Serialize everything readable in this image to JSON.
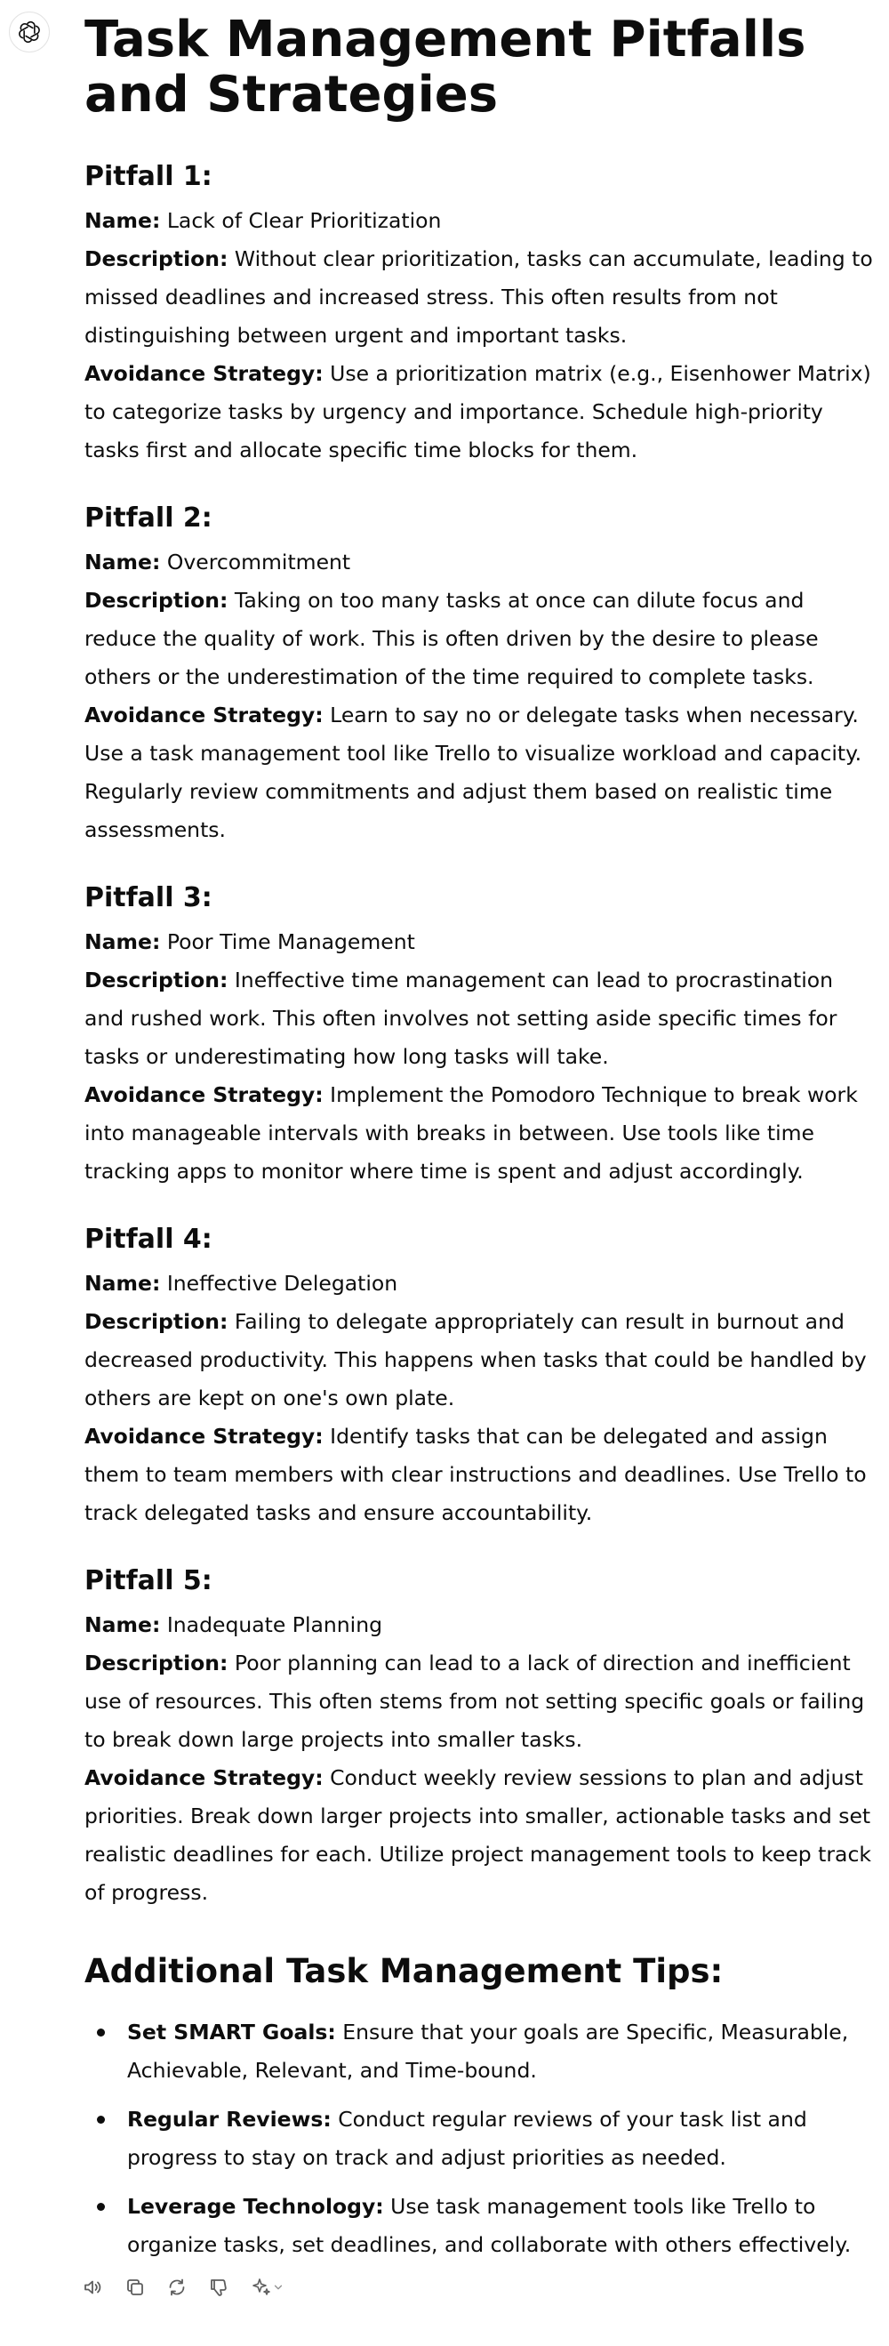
{
  "title": "Task Management Pitfalls and Strategies",
  "labels": {
    "name": "Name:",
    "description": "Description:",
    "strategy": "Avoidance Strategy:"
  },
  "pitfalls": [
    {
      "heading": "Pitfall 1:",
      "name": "Lack of Clear Prioritization",
      "description": "Without clear prioritization, tasks can accumulate, leading to missed deadlines and increased stress. This often results from not distinguishing between urgent and important tasks.",
      "strategy": "Use a prioritization matrix (e.g., Eisenhower Matrix) to categorize tasks by urgency and importance. Schedule high-priority tasks first and allocate specific time blocks for them."
    },
    {
      "heading": "Pitfall 2:",
      "name": "Overcommitment",
      "description": "Taking on too many tasks at once can dilute focus and reduce the quality of work. This is often driven by the desire to please others or the underestimation of the time required to complete tasks.",
      "strategy": "Learn to say no or delegate tasks when necessary. Use a task management tool like Trello to visualize workload and capacity. Regularly review commitments and adjust them based on realistic time assessments."
    },
    {
      "heading": "Pitfall 3:",
      "name": "Poor Time Management",
      "description": "Ineffective time management can lead to procrastination and rushed work. This often involves not setting aside specific times for tasks or underestimating how long tasks will take.",
      "strategy": "Implement the Pomodoro Technique to break work into manageable intervals with breaks in between. Use tools like time tracking apps to monitor where time is spent and adjust accordingly."
    },
    {
      "heading": "Pitfall 4:",
      "name": "Ineffective Delegation",
      "description": "Failing to delegate appropriately can result in burnout and decreased productivity. This happens when tasks that could be handled by others are kept on one's own plate.",
      "strategy": "Identify tasks that can be delegated and assign them to team members with clear instructions and deadlines. Use Trello to track delegated tasks and ensure accountability."
    },
    {
      "heading": "Pitfall 5:",
      "name": "Inadequate Planning",
      "description": "Poor planning can lead to a lack of direction and inefficient use of resources. This often stems from not setting specific goals or failing to break down large projects into smaller tasks.",
      "strategy": "Conduct weekly review sessions to plan and adjust priorities. Break down larger projects into smaller, actionable tasks and set realistic deadlines for each. Utilize project management tools to keep track of progress."
    }
  ],
  "tips": {
    "heading": "Additional Task Management Tips:",
    "items": [
      {
        "label": "Set SMART Goals:",
        "text": "Ensure that your goals are Specific, Measurable, Achievable, Relevant, and Time-bound."
      },
      {
        "label": "Regular Reviews:",
        "text": "Conduct regular reviews of your task list and progress to stay on track and adjust priorities as needed."
      },
      {
        "label": "Leverage Technology:",
        "text": "Use task management tools like Trello to organize tasks, set deadlines, and collaborate with others effectively."
      }
    ]
  },
  "icons": {
    "avatar": "openai-logo-icon",
    "actions": [
      "speaker-icon",
      "copy-icon",
      "regenerate-icon",
      "thumbs-down-icon",
      "sparkle-icon",
      "chevron-down-icon"
    ]
  }
}
